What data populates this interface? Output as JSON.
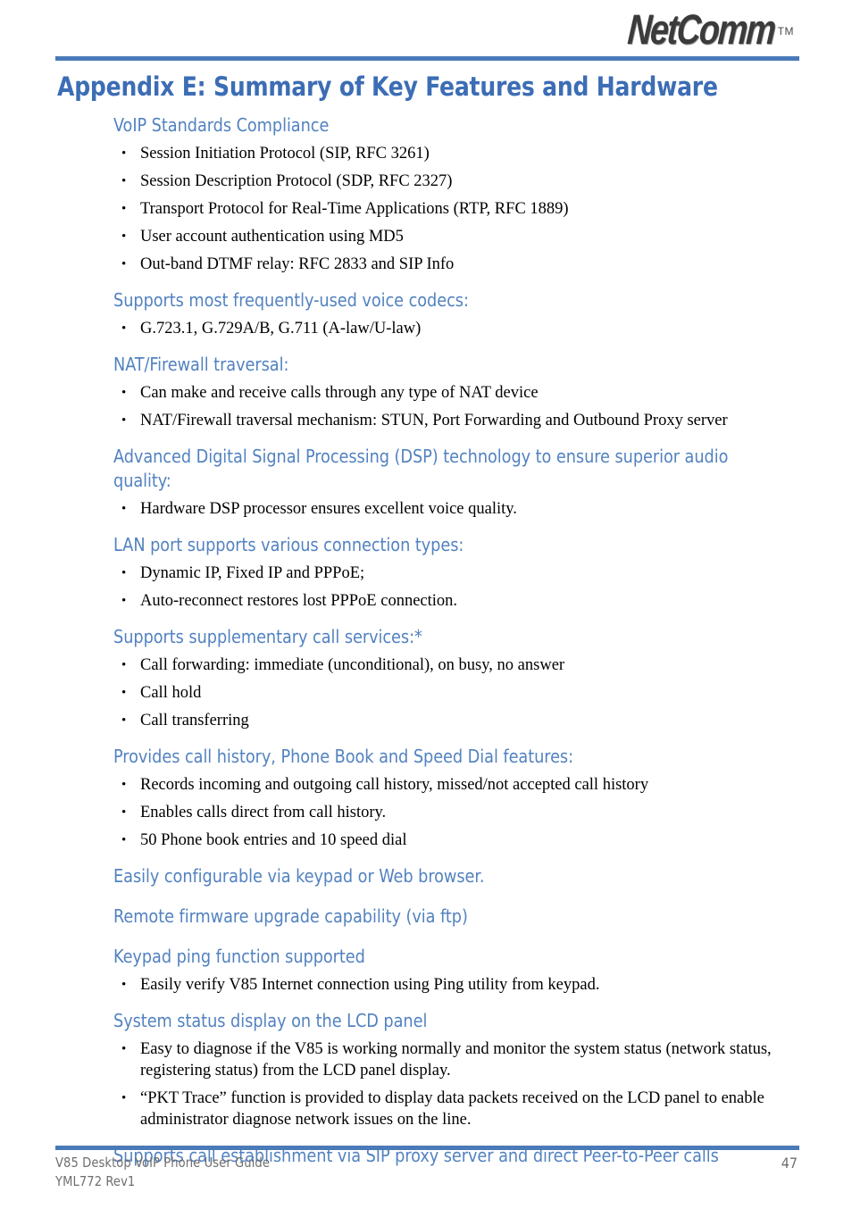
{
  "header": {
    "logo_text": "NetComm",
    "logo_tm": "TM",
    "rule_color": "#4a7ab8"
  },
  "title": "Appendix E:  Summary of Key Features and Hardware",
  "colors": {
    "title_blue": "#3c6db5",
    "heading_blue": "#5282c0",
    "rule_blue": "#4a7ab8",
    "body_black": "#000000",
    "footer_gray": "#6e6e6e"
  },
  "sections": [
    {
      "heading": "VoIP Standards Compliance",
      "bullets": [
        "Session Initiation Protocol (SIP, RFC 3261)",
        "Session Description Protocol (SDP, RFC 2327)",
        "Transport Protocol for Real-Time Applications (RTP, RFC 1889)",
        "User account authentication using MD5",
        "Out-band DTMF relay: RFC 2833 and SIP Info"
      ]
    },
    {
      "heading": "Supports most frequently-used voice codecs:",
      "bullets": [
        "G.723.1, G.729A/B, G.711 (A-law/U-law)"
      ]
    },
    {
      "heading": "NAT/Firewall traversal:",
      "bullets": [
        "Can make and receive calls through any type of NAT device",
        "NAT/Firewall traversal mechanism: STUN, Port Forwarding and Outbound Proxy server"
      ]
    },
    {
      "heading": "Advanced Digital Signal Processing (DSP) technology to ensure superior audio quality:",
      "bullets": [
        "Hardware DSP processor ensures excellent voice quality."
      ]
    },
    {
      "heading": "LAN port supports various connection types:",
      "bullets": [
        "Dynamic IP, Fixed IP and PPPoE;",
        "Auto-reconnect restores lost PPPoE connection."
      ]
    },
    {
      "heading": "Supports supplementary call services:*",
      "bullets": [
        "Call forwarding: immediate (unconditional), on busy, no answer",
        "Call hold",
        "Call transferring"
      ]
    },
    {
      "heading": "Provides call history, Phone Book and Speed Dial features:",
      "bullets": [
        "Records incoming and outgoing call history, missed/not accepted call history",
        "Enables calls direct from call history.",
        "50 Phone book entries and 10 speed dial"
      ]
    },
    {
      "heading": "Easily configurable via keypad or Web browser.",
      "bullets": []
    },
    {
      "heading": "Remote firmware upgrade capability (via ftp)",
      "bullets": []
    },
    {
      "heading": "Keypad ping function supported",
      "bullets": [
        "Easily verify V85 Internet connection using Ping utility from keypad."
      ]
    },
    {
      "heading": "System status display on the LCD panel",
      "bullets": [
        "Easy to diagnose if the V85 is working normally and monitor the system status (network status, registering status) from the LCD panel display.",
        "“PKT Trace” function is provided to display data packets received on the LCD panel to enable administrator diagnose network issues on the line."
      ]
    },
    {
      "heading": "Supports call establishment via SIP proxy server and direct Peer-to-Peer calls",
      "bullets": []
    }
  ],
  "footer": {
    "line1": "V85 Desktop VoIP Phone User Guide",
    "line2": "YML772 Rev1",
    "page_number": "47"
  }
}
